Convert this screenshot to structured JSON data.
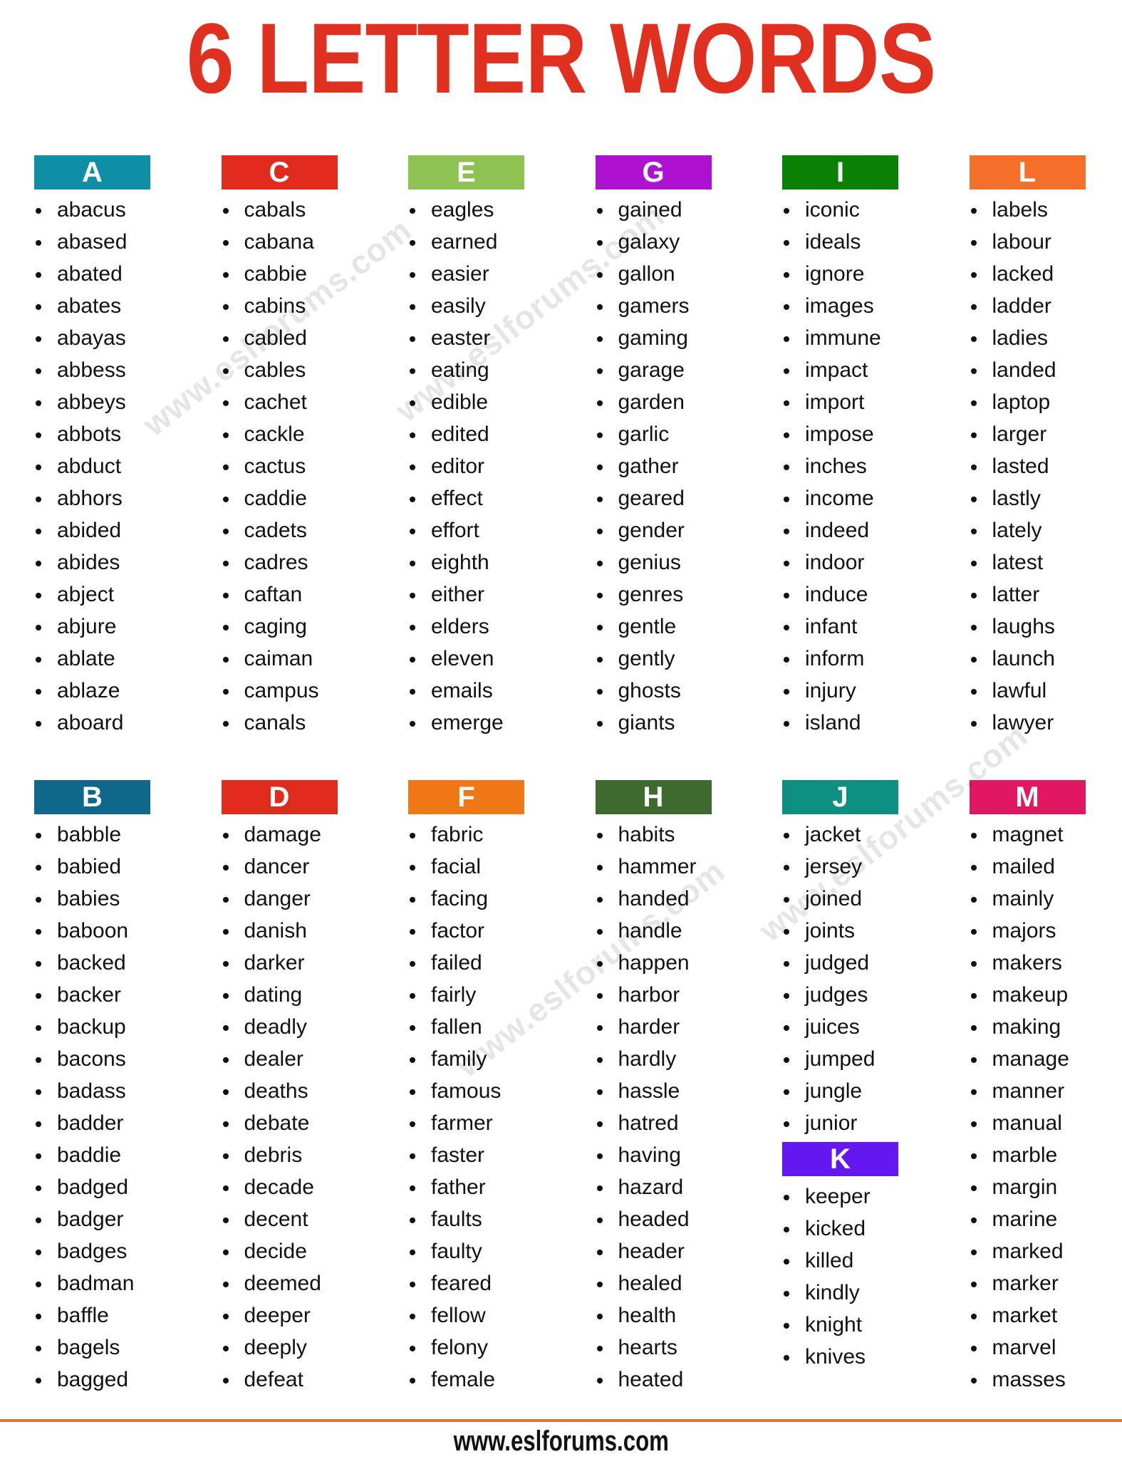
{
  "title": "6 LETTER WORDS",
  "footer": {
    "site": "www.eslforums.com",
    "rule_color": "#e0703c"
  },
  "watermarks": [
    "www.eslforums.com",
    "www.eslforums.com",
    "www.eslforums.com",
    "www.eslforums.com"
  ],
  "theme": {
    "title_color": "#e03020",
    "text_color": "#111111",
    "background": "#ffffff"
  },
  "columns_top": [
    {
      "letter": "A",
      "color": "#0f8fa5",
      "words": [
        "abacus",
        "abased",
        "abated",
        "abates",
        "abayas",
        "abbess",
        "abbeys",
        "abbots",
        "abduct",
        "abhors",
        "abided",
        "abides",
        "abject",
        "abjure",
        "ablate",
        "ablaze",
        "aboard"
      ]
    },
    {
      "letter": "C",
      "color": "#e02b1c",
      "words": [
        "cabals",
        "cabana",
        "cabbie",
        "cabins",
        "cabled",
        "cables",
        "cachet",
        "cackle",
        "cactus",
        "caddie",
        "cadets",
        "cadres",
        "caftan",
        "caging",
        "caiman",
        "campus",
        "canals"
      ]
    },
    {
      "letter": "E",
      "color": "#8dc152",
      "words": [
        "eagles",
        "earned",
        "easier",
        "easily",
        "easter",
        "eating",
        "edible",
        "edited",
        "editor",
        "effect",
        "effort",
        "eighth",
        "either",
        "elders",
        "eleven",
        "emails",
        "emerge"
      ]
    },
    {
      "letter": "G",
      "color": "#ad12d0",
      "words": [
        "gained",
        "galaxy",
        "gallon",
        "gamers",
        "gaming",
        "garage",
        "garden",
        "garlic",
        "gather",
        "geared",
        "gender",
        "genius",
        "genres",
        "gentle",
        "gently",
        "ghosts",
        "giants"
      ]
    },
    {
      "letter": "I",
      "color": "#0a8005",
      "words": [
        "iconic",
        "ideals",
        "ignore",
        "images",
        "immune",
        "impact",
        "import",
        "impose",
        "inches",
        "income",
        "indeed",
        "indoor",
        "induce",
        "infant",
        "inform",
        "injury",
        "island"
      ]
    },
    {
      "letter": "L",
      "color": "#f4702a",
      "words": [
        "labels",
        "labour",
        "lacked",
        "ladder",
        "ladies",
        "landed",
        "laptop",
        "larger",
        "lasted",
        "lastly",
        "lately",
        "latest",
        "latter",
        "laughs",
        "launch",
        "lawful",
        "lawyer"
      ]
    }
  ],
  "columns_bottom": [
    {
      "letter": "B",
      "color": "#10678c",
      "words": [
        "babble",
        "babied",
        "babies",
        "baboon",
        "backed",
        "backer",
        "backup",
        "bacons",
        "badass",
        "badder",
        "baddie",
        "badged",
        "badger",
        "badges",
        "badman",
        "baffle",
        "bagels",
        "bagged"
      ]
    },
    {
      "letter": "D",
      "color": "#e02b1c",
      "words": [
        "damage",
        "dancer",
        "danger",
        "danish",
        "darker",
        "dating",
        "deadly",
        "dealer",
        "deaths",
        "debate",
        "debris",
        "decade",
        "decent",
        "decide",
        "deemed",
        "deeper",
        "deeply",
        "defeat"
      ]
    },
    {
      "letter": "F",
      "color": "#ef7716",
      "words": [
        "fabric",
        "facial",
        "facing",
        "factor",
        "failed",
        "fairly",
        "fallen",
        "family",
        "famous",
        "farmer",
        "faster",
        "father",
        "faults",
        "faulty",
        "feared",
        "fellow",
        "felony",
        "female"
      ]
    },
    {
      "letter": "H",
      "color": "#3d6b2e",
      "words": [
        "habits",
        "hammer",
        "handed",
        "handle",
        "happen",
        "harbor",
        "harder",
        "hardly",
        "hassle",
        "hatred",
        "having",
        "hazard",
        "headed",
        "header",
        "healed",
        "health",
        "hearts",
        "heated"
      ]
    },
    {
      "letter": "J",
      "color": "#0d8f82",
      "words": [
        "jacket",
        "jersey",
        "joined",
        "joints",
        "judged",
        "judges",
        "juices",
        "jumped",
        "jungle",
        "junior"
      ],
      "sub_section": {
        "letter": "K",
        "color": "#6218ee",
        "words": [
          "keeper",
          "kicked",
          "killed",
          "kindly",
          "knight",
          "knives"
        ]
      }
    },
    {
      "letter": "M",
      "color": "#e01862",
      "words": [
        "magnet",
        "mailed",
        "mainly",
        "majors",
        "makers",
        "makeup",
        "making",
        "manage",
        "manner",
        "manual",
        "marble",
        "margin",
        "marine",
        "marked",
        "marker",
        "market",
        "marvel",
        "masses"
      ]
    }
  ]
}
